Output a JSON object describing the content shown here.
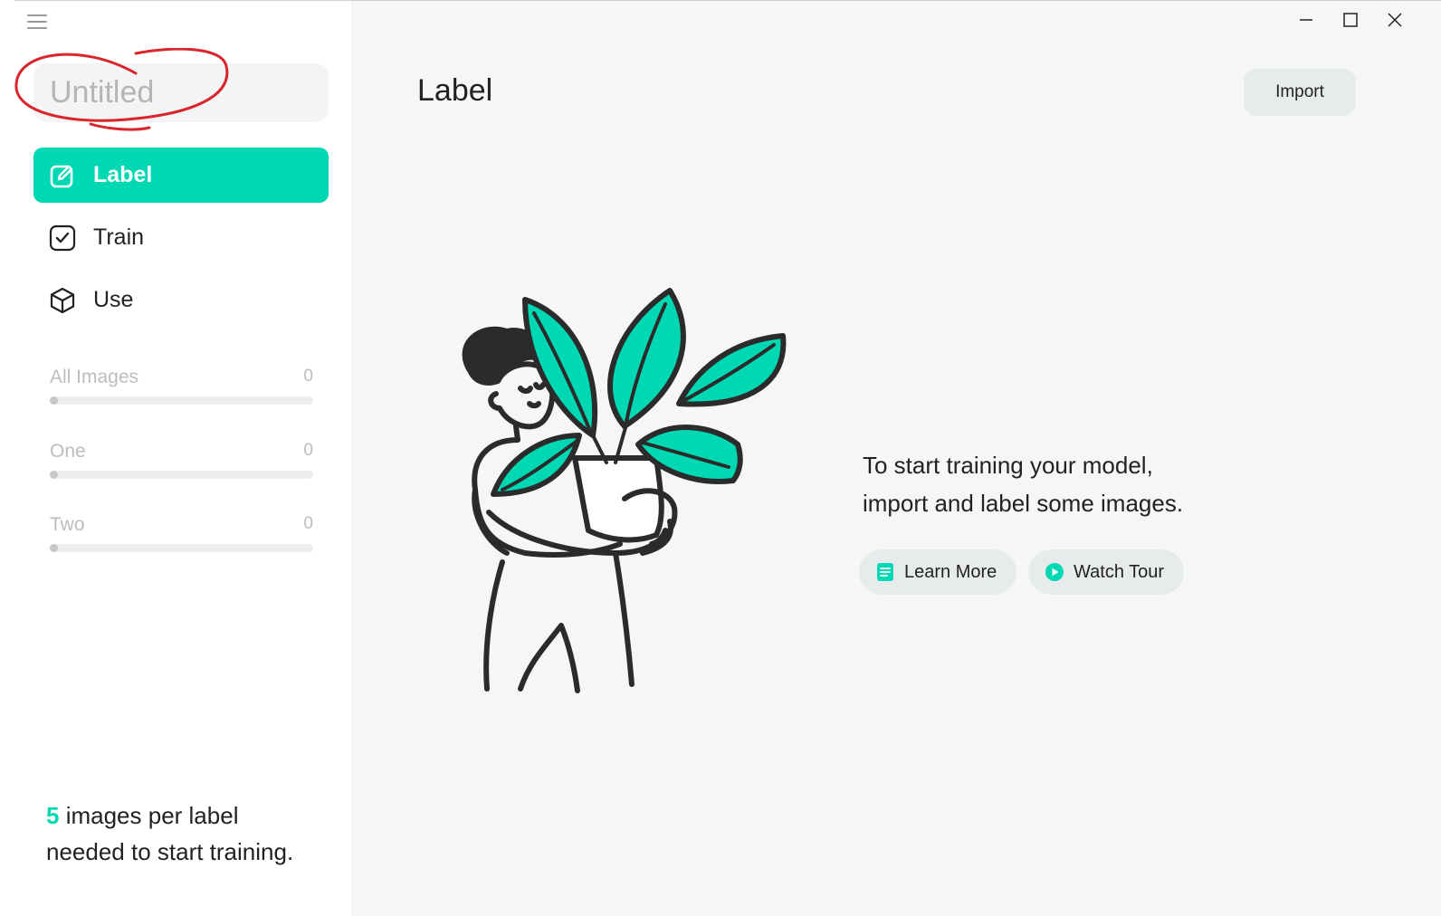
{
  "sidebar": {
    "project_title_placeholder": "Untitled",
    "nav": [
      {
        "label": "Label",
        "icon": "edit-icon",
        "active": true
      },
      {
        "label": "Train",
        "icon": "checkbox-icon",
        "active": false
      },
      {
        "label": "Use",
        "icon": "cube-icon",
        "active": false
      }
    ],
    "stats": [
      {
        "name": "All Images",
        "count": "0",
        "progress": 0
      },
      {
        "name": "One",
        "count": "0",
        "progress": 0
      },
      {
        "name": "Two",
        "count": "0",
        "progress": 0
      }
    ],
    "hint": {
      "number": "5",
      "text_line1": " images per label",
      "text_line2": "needed to start training."
    }
  },
  "main": {
    "title": "Label",
    "import_label": "Import",
    "message_line1": "To start training your model,",
    "message_line2": "import and label some images.",
    "learn_more_label": "Learn More",
    "watch_tour_label": "Watch Tour"
  },
  "colors": {
    "accent": "#00d8b4",
    "annotation": "#d9262c",
    "main_bg": "#f5f6f8",
    "button_bg": "#e8ebec"
  }
}
